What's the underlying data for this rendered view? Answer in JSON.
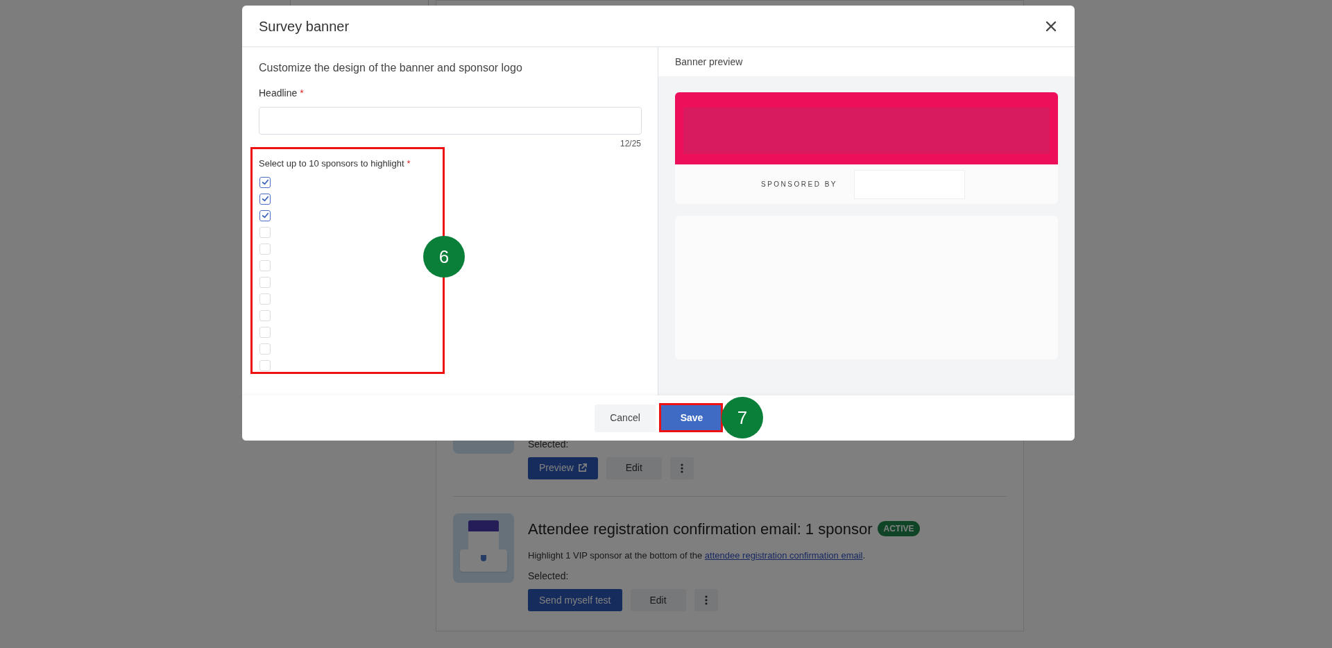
{
  "background_page": {
    "items": [
      {
        "selected_label": "Selected:",
        "buttons": [
          {
            "kind": "primary",
            "label": "Preview",
            "external": true
          },
          {
            "kind": "secondary",
            "label": "Edit"
          },
          {
            "kind": "more"
          }
        ]
      },
      {
        "title": "Attendee registration confirmation email: 1 sponsor",
        "badge": "ACTIVE",
        "description": "Highlight 1 VIP sponsor at the bottom of the",
        "link": "attendee registration confirmation email",
        "description_end": ".",
        "selected_label": "Selected:",
        "buttons": [
          {
            "kind": "primary",
            "label": "Send myself test",
            "external": false
          },
          {
            "kind": "secondary",
            "label": "Edit"
          },
          {
            "kind": "more"
          }
        ]
      }
    ]
  },
  "modal": {
    "title": "Survey banner",
    "subtitle": "Customize the design of the banner and sponsor logo",
    "headline": {
      "label": "Headline",
      "required_mark": "*",
      "counter": "12/25"
    },
    "sponsors": {
      "label": "Select up to 10 sponsors to highlight",
      "required_mark": "*",
      "checkboxes": [
        {
          "checked": true
        },
        {
          "checked": true
        },
        {
          "checked": true
        },
        {
          "checked": false
        },
        {
          "checked": false
        },
        {
          "checked": false
        },
        {
          "checked": false
        },
        {
          "checked": false
        },
        {
          "checked": false
        },
        {
          "checked": false
        },
        {
          "checked": false
        },
        {
          "checked": false
        }
      ]
    },
    "preview": {
      "title": "Banner preview",
      "sponsored_by": "SPONSORED BY"
    },
    "footer": {
      "cancel": "Cancel",
      "save": "Save"
    }
  },
  "annotations": [
    {
      "label": "6"
    },
    {
      "label": "7"
    }
  ]
}
